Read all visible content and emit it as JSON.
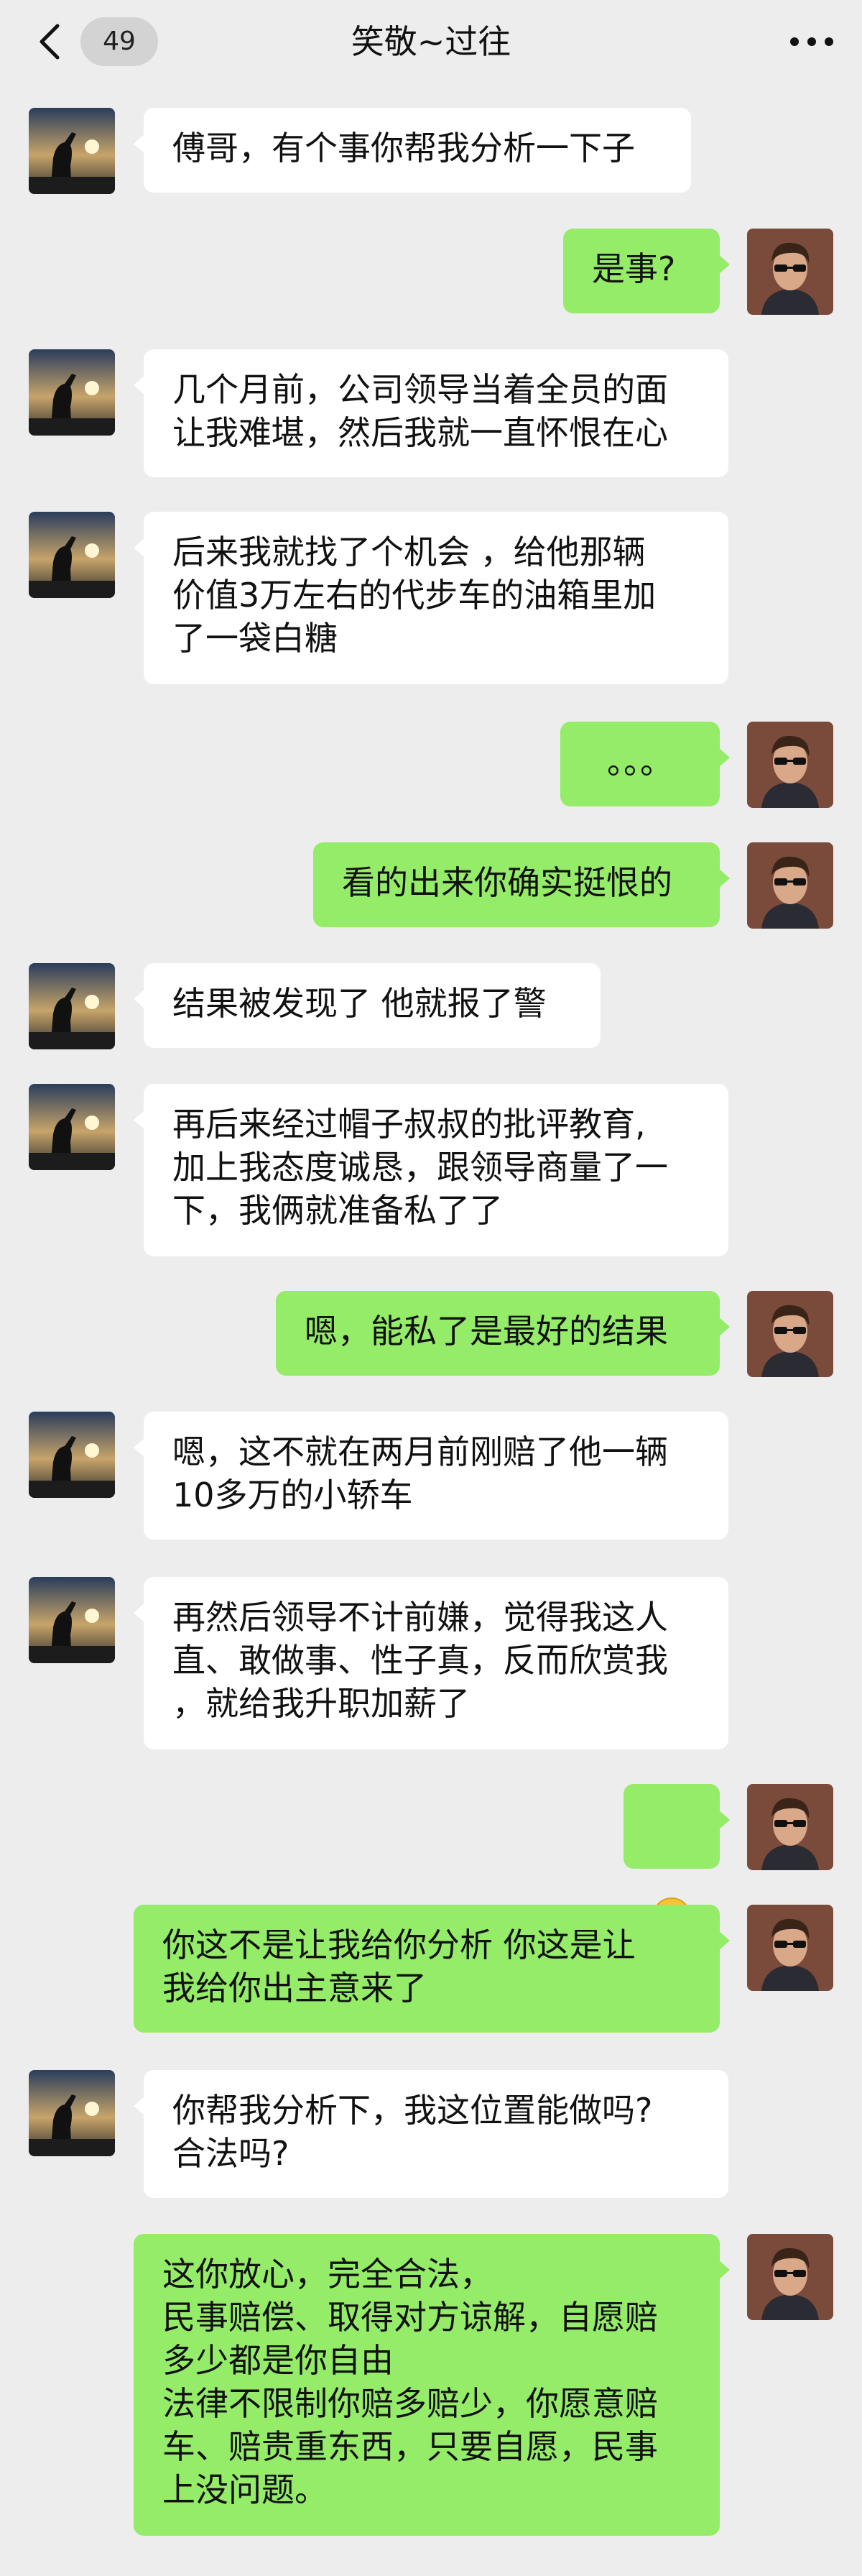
{
  "header": {
    "unread_count": "49",
    "title": "笑敬~过往"
  },
  "icons": {
    "back": "chevron-left-icon",
    "more": "more-dots-icon",
    "contact_avatar": "contact-avatar-sunset-silhouette",
    "self_avatar": "self-avatar-portrait-sunglasses",
    "emoji": "surprised-face-emoji"
  },
  "colors": {
    "background": "#ededed",
    "incoming_bubble": "#ffffff",
    "outgoing_bubble": "#95ec69"
  },
  "messages": [
    {
      "from": "contact",
      "text": "傅哥，有个事你帮我分析一下子"
    },
    {
      "from": "self",
      "text": "是事?"
    },
    {
      "from": "contact",
      "text": "几个月前，公司领导当着全员的面\n让我难堪，然后我就一直怀恨在心"
    },
    {
      "from": "contact",
      "text": "后来我就找了个机会 ，给他那辆\n价值3万左右的代步车的油箱里加\n了一袋白糖"
    },
    {
      "from": "self",
      "text": "。。。"
    },
    {
      "from": "self",
      "text": "看的出来你确实挺恨的"
    },
    {
      "from": "contact",
      "text": "结果被发现了 他就报了警"
    },
    {
      "from": "contact",
      "text": "再后来经过帽子叔叔的批评教育,\n加上我态度诚恳，跟领导商量了一\n下，我俩就准备私了了"
    },
    {
      "from": "self",
      "text": "嗯，能私了是最好的结果"
    },
    {
      "from": "contact",
      "text": "嗯，这不就在两月前刚赔了他一辆\n10多万的小轿车"
    },
    {
      "from": "contact",
      "text": "再然后领导不计前嫌，觉得我这人\n直、敢做事、性子真，反而欣赏我\n，就给我升职加薪了"
    },
    {
      "from": "self",
      "text": ""
    },
    {
      "from": "self",
      "text": "你这不是让我给你分析 你这是让\n我给你出主意来了"
    },
    {
      "from": "contact",
      "text": "你帮我分析下，我这位置能做吗?\n合法吗?"
    },
    {
      "from": "self",
      "text": "这你放心，完全合法，\n民事赔偿、取得对方谅解，自愿赔\n多少都是你自由\n法律不限制你赔多赔少，你愿意赔\n车、赔贵重东西，只要自愿，民事\n上没问题。"
    }
  ]
}
